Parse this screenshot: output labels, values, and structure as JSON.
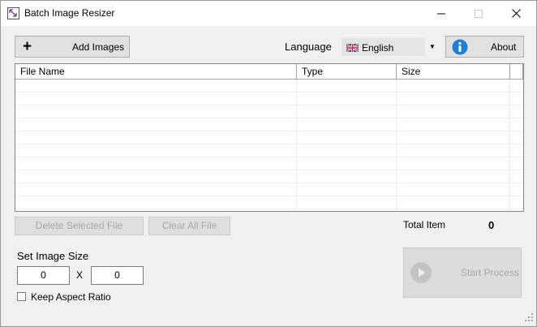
{
  "window": {
    "title": "Batch Image Resizer"
  },
  "toolbar": {
    "add_images_label": "Add Images",
    "language_label": "Language",
    "language_value": "English",
    "about_label": "About"
  },
  "table": {
    "columns": [
      "File Name",
      "Type",
      "Size",
      ""
    ],
    "rows": []
  },
  "actions": {
    "delete_label": "Delete Selected File",
    "clear_label": "Clear All File"
  },
  "summary": {
    "total_label": "Total Item",
    "total_value": "0"
  },
  "image_size": {
    "label": "Set Image Size",
    "width": "0",
    "separator": "X",
    "height": "0",
    "keep_aspect_label": "Keep Aspect Ratio",
    "keep_aspect_checked": false
  },
  "process": {
    "start_label": "Start Process"
  },
  "colors": {
    "info_blue": "#1e7fd6",
    "disabled_text": "#a8a8a8",
    "border": "#adadad"
  }
}
